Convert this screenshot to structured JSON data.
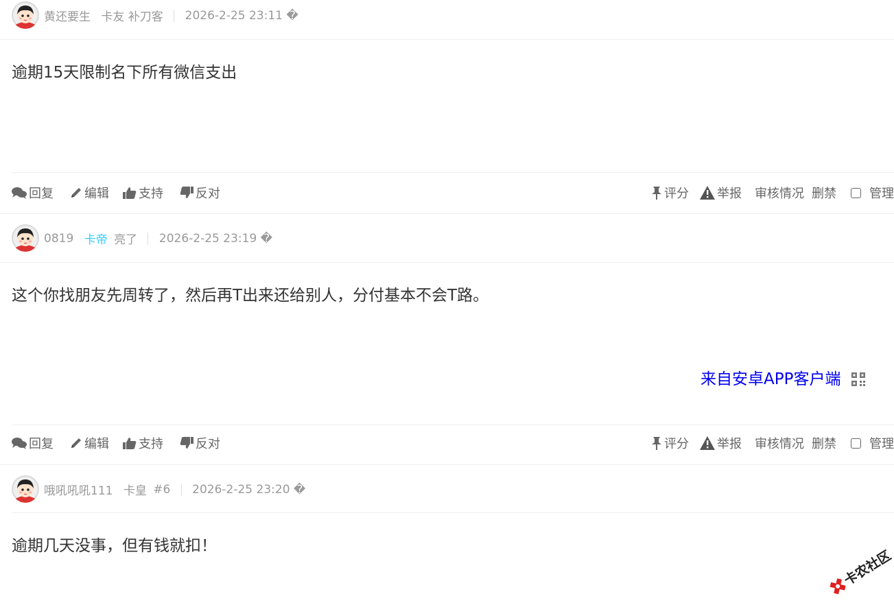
{
  "posts": [
    {
      "username": "黄还要生",
      "group": "卡友 补刀客",
      "timestamp": "2026-2-25 23:11 �",
      "content": "逾期15天限制名下所有微信支出"
    },
    {
      "username": "0819",
      "group": "卡帝",
      "group_suffix": "亮了",
      "timestamp": "2026-2-25 23:19 �",
      "content": "这个你找朋友先周转了，然后再T出来还给别人，分付基本不会T路。",
      "source": "来自安卓APP客户端"
    },
    {
      "username": "哦吼吼吼111",
      "group": "卡皇",
      "floor": "#6",
      "timestamp": "2026-2-25 23:20 �",
      "content": "逾期几天没事，但有钱就扣！"
    }
  ],
  "actions": {
    "reply": "回复",
    "edit": "编辑",
    "support": "支持",
    "oppose": "反对",
    "rate": "评分",
    "report": "举报",
    "review": "审核情况",
    "ban": "删禁",
    "manage": "管理"
  },
  "colors": {
    "meta_gray": "#999999",
    "group_cyan": "#33ccff",
    "link_blue": "#0000ee",
    "watermark_red": "#e02020"
  },
  "icons": [
    "avatar-cartoon",
    "comments-icon",
    "pencil-icon",
    "thumbs-up-icon",
    "thumbs-down-icon",
    "pushpin-icon",
    "warning-icon",
    "qrcode-icon"
  ],
  "watermark": "卡农社区"
}
